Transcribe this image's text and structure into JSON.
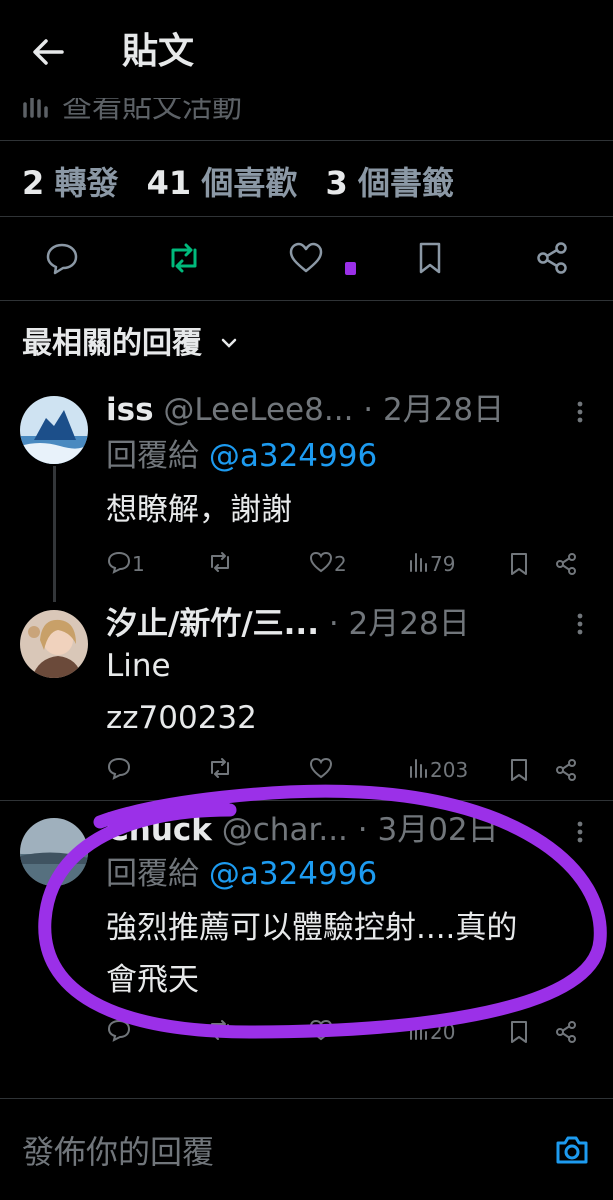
{
  "header": {
    "title": "貼文"
  },
  "activity": {
    "label": "查看貼文活動"
  },
  "stats": {
    "reposts_num": "2",
    "reposts_label": "轉發",
    "likes_num": "41",
    "likes_label": "個喜歡",
    "bookmarks_num": "3",
    "bookmarks_label": "個書籤"
  },
  "sort": {
    "label": "最相關的回覆"
  },
  "replies": [
    {
      "name": "iss",
      "handle": "@LeeLee8...",
      "date": "· 2月28日",
      "replying_prefix": "回覆給",
      "replying_to": "@a324996",
      "text": "想瞭解，謝謝",
      "replies": "1",
      "retweets": "",
      "likes": "2",
      "views": "79"
    },
    {
      "name": "汐止/新竹/三...",
      "handle": "",
      "date": "· 2月28日",
      "line1": "Line",
      "line2": "zz700232",
      "replies": "",
      "retweets": "",
      "likes": "",
      "views": "203"
    },
    {
      "name": "Chuck",
      "handle": "@char...",
      "date": "· 3月02日",
      "replying_prefix": "回覆給",
      "replying_to": "@a324996",
      "line1": "強烈推薦可以體驗控射....真的",
      "line2": "會飛天",
      "replies": "",
      "retweets": "",
      "likes": "",
      "views": "20"
    }
  ],
  "composer": {
    "placeholder": "發佈你的回覆"
  },
  "colors": {
    "accent": "#1d9bf0",
    "retweet_active": "#00ba7c",
    "annotation": "#9b30e8"
  }
}
